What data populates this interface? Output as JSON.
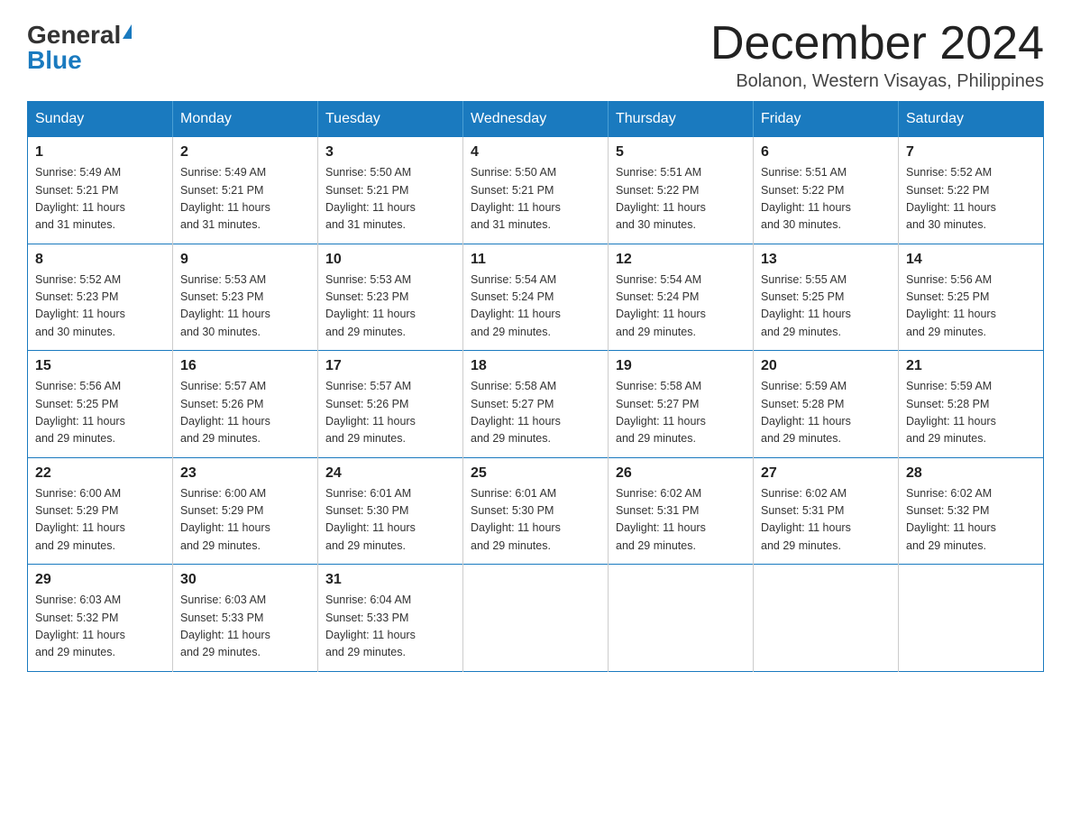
{
  "logo": {
    "general": "General",
    "blue": "Blue"
  },
  "title": "December 2024",
  "location": "Bolanon, Western Visayas, Philippines",
  "days_of_week": [
    "Sunday",
    "Monday",
    "Tuesday",
    "Wednesday",
    "Thursday",
    "Friday",
    "Saturday"
  ],
  "weeks": [
    [
      {
        "day": "1",
        "sunrise": "5:49 AM",
        "sunset": "5:21 PM",
        "daylight": "11 hours and 31 minutes."
      },
      {
        "day": "2",
        "sunrise": "5:49 AM",
        "sunset": "5:21 PM",
        "daylight": "11 hours and 31 minutes."
      },
      {
        "day": "3",
        "sunrise": "5:50 AM",
        "sunset": "5:21 PM",
        "daylight": "11 hours and 31 minutes."
      },
      {
        "day": "4",
        "sunrise": "5:50 AM",
        "sunset": "5:21 PM",
        "daylight": "11 hours and 31 minutes."
      },
      {
        "day": "5",
        "sunrise": "5:51 AM",
        "sunset": "5:22 PM",
        "daylight": "11 hours and 30 minutes."
      },
      {
        "day": "6",
        "sunrise": "5:51 AM",
        "sunset": "5:22 PM",
        "daylight": "11 hours and 30 minutes."
      },
      {
        "day": "7",
        "sunrise": "5:52 AM",
        "sunset": "5:22 PM",
        "daylight": "11 hours and 30 minutes."
      }
    ],
    [
      {
        "day": "8",
        "sunrise": "5:52 AM",
        "sunset": "5:23 PM",
        "daylight": "11 hours and 30 minutes."
      },
      {
        "day": "9",
        "sunrise": "5:53 AM",
        "sunset": "5:23 PM",
        "daylight": "11 hours and 30 minutes."
      },
      {
        "day": "10",
        "sunrise": "5:53 AM",
        "sunset": "5:23 PM",
        "daylight": "11 hours and 29 minutes."
      },
      {
        "day": "11",
        "sunrise": "5:54 AM",
        "sunset": "5:24 PM",
        "daylight": "11 hours and 29 minutes."
      },
      {
        "day": "12",
        "sunrise": "5:54 AM",
        "sunset": "5:24 PM",
        "daylight": "11 hours and 29 minutes."
      },
      {
        "day": "13",
        "sunrise": "5:55 AM",
        "sunset": "5:25 PM",
        "daylight": "11 hours and 29 minutes."
      },
      {
        "day": "14",
        "sunrise": "5:56 AM",
        "sunset": "5:25 PM",
        "daylight": "11 hours and 29 minutes."
      }
    ],
    [
      {
        "day": "15",
        "sunrise": "5:56 AM",
        "sunset": "5:25 PM",
        "daylight": "11 hours and 29 minutes."
      },
      {
        "day": "16",
        "sunrise": "5:57 AM",
        "sunset": "5:26 PM",
        "daylight": "11 hours and 29 minutes."
      },
      {
        "day": "17",
        "sunrise": "5:57 AM",
        "sunset": "5:26 PM",
        "daylight": "11 hours and 29 minutes."
      },
      {
        "day": "18",
        "sunrise": "5:58 AM",
        "sunset": "5:27 PM",
        "daylight": "11 hours and 29 minutes."
      },
      {
        "day": "19",
        "sunrise": "5:58 AM",
        "sunset": "5:27 PM",
        "daylight": "11 hours and 29 minutes."
      },
      {
        "day": "20",
        "sunrise": "5:59 AM",
        "sunset": "5:28 PM",
        "daylight": "11 hours and 29 minutes."
      },
      {
        "day": "21",
        "sunrise": "5:59 AM",
        "sunset": "5:28 PM",
        "daylight": "11 hours and 29 minutes."
      }
    ],
    [
      {
        "day": "22",
        "sunrise": "6:00 AM",
        "sunset": "5:29 PM",
        "daylight": "11 hours and 29 minutes."
      },
      {
        "day": "23",
        "sunrise": "6:00 AM",
        "sunset": "5:29 PM",
        "daylight": "11 hours and 29 minutes."
      },
      {
        "day": "24",
        "sunrise": "6:01 AM",
        "sunset": "5:30 PM",
        "daylight": "11 hours and 29 minutes."
      },
      {
        "day": "25",
        "sunrise": "6:01 AM",
        "sunset": "5:30 PM",
        "daylight": "11 hours and 29 minutes."
      },
      {
        "day": "26",
        "sunrise": "6:02 AM",
        "sunset": "5:31 PM",
        "daylight": "11 hours and 29 minutes."
      },
      {
        "day": "27",
        "sunrise": "6:02 AM",
        "sunset": "5:31 PM",
        "daylight": "11 hours and 29 minutes."
      },
      {
        "day": "28",
        "sunrise": "6:02 AM",
        "sunset": "5:32 PM",
        "daylight": "11 hours and 29 minutes."
      }
    ],
    [
      {
        "day": "29",
        "sunrise": "6:03 AM",
        "sunset": "5:32 PM",
        "daylight": "11 hours and 29 minutes."
      },
      {
        "day": "30",
        "sunrise": "6:03 AM",
        "sunset": "5:33 PM",
        "daylight": "11 hours and 29 minutes."
      },
      {
        "day": "31",
        "sunrise": "6:04 AM",
        "sunset": "5:33 PM",
        "daylight": "11 hours and 29 minutes."
      },
      null,
      null,
      null,
      null
    ]
  ],
  "labels": {
    "sunrise": "Sunrise:",
    "sunset": "Sunset:",
    "daylight": "Daylight:"
  }
}
